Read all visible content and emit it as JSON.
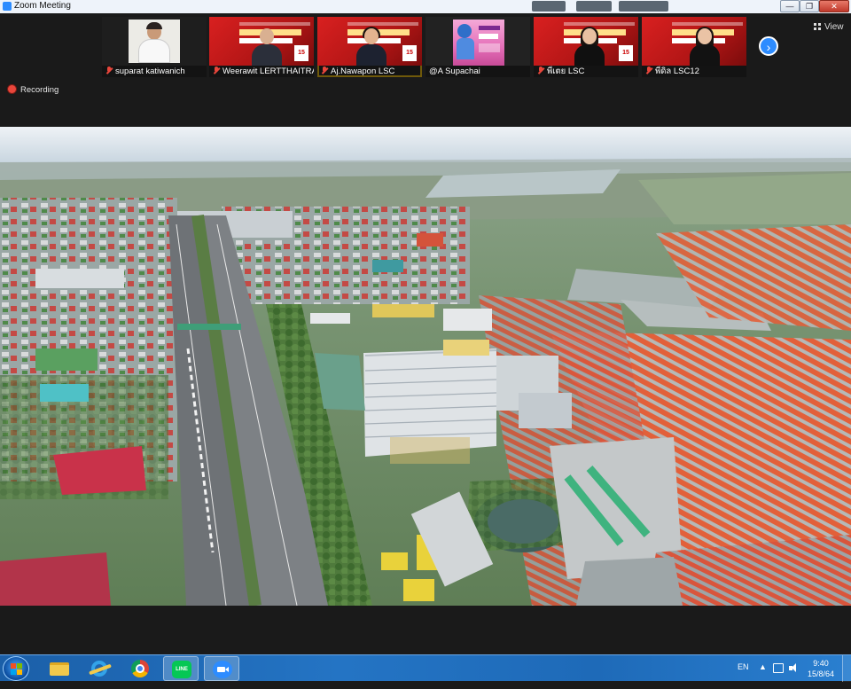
{
  "window": {
    "title": "Zoom Meeting",
    "controls": {
      "minimize": "—",
      "maximize": "❐",
      "close": "✕"
    }
  },
  "gallery": {
    "participants": [
      {
        "name": "suparat katiwanich",
        "muted": true,
        "video": "webcam"
      },
      {
        "name": "Weerawit LERTTHAITRAKUL",
        "muted": true,
        "video": "poster"
      },
      {
        "name": "Aj.Nawapon LSC",
        "muted": true,
        "video": "poster",
        "active_speaker": true
      },
      {
        "name": "@A Supachai",
        "muted": false,
        "video": "poster-blue"
      },
      {
        "name": "พี่เตย LSC",
        "muted": true,
        "video": "poster"
      },
      {
        "name": "พี่ดิล LSC12",
        "muted": true,
        "video": "poster"
      }
    ],
    "poster_badge": "15",
    "next_button": "›",
    "view_label": "View"
  },
  "recording": {
    "label": "Recording"
  },
  "shared_screen": {
    "content": "aerial-city-view"
  },
  "taskbar": {
    "apps": [
      {
        "name": "file-explorer",
        "icon": "folder-icon"
      },
      {
        "name": "internet-explorer",
        "icon": "ie-icon"
      },
      {
        "name": "chrome",
        "icon": "chrome-icon"
      },
      {
        "name": "line",
        "icon": "line-icon",
        "label": "LINE"
      },
      {
        "name": "zoom",
        "icon": "zoom-icon"
      }
    ],
    "language": "EN",
    "tray_arrow": "▲",
    "time": "9:40",
    "date": "15/8/64"
  },
  "colors": {
    "zoom_blue": "#2d8cff",
    "taskbar": "#1e6ab8",
    "meeting_bg": "#1a1a1a",
    "recording_red": "#e8463b",
    "active_speaker": "#f5c518"
  }
}
